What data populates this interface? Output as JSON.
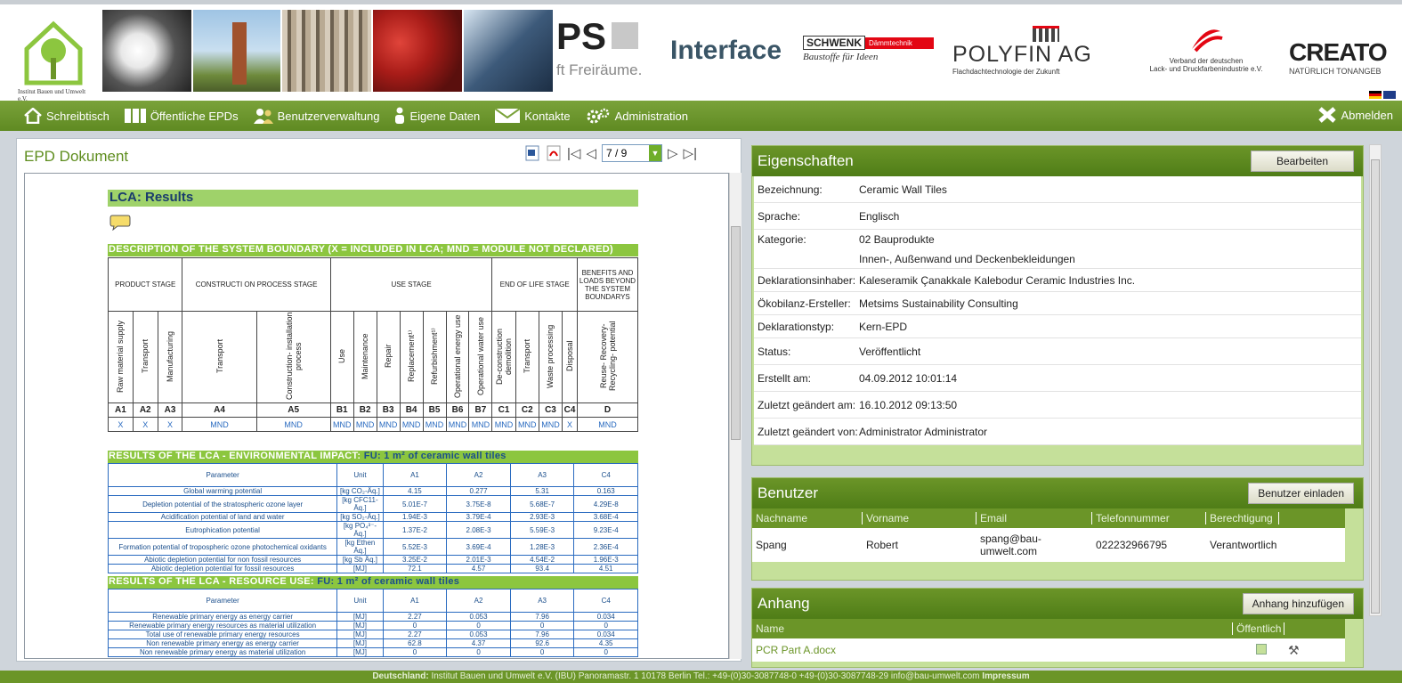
{
  "header": {
    "logo_text": "Institut Bauen\nund Umwelt e.V.",
    "ps_partial": "PS",
    "freiraeume": "ft Freiräume.",
    "interface": "Interface",
    "schwenk": "SCHWENK",
    "schwenk_sub": "Dämmtechnik",
    "schwenk_slogan": "Baustoffe für Ideen",
    "polyfin": "POLYFIN AG",
    "polyfin_sub": "Flachdachtechnologie der Zukunft",
    "verband": "Verband der deutschen",
    "verband2": "Lack- und Druckfarbenindustrie e.V.",
    "creaton": "CREATO",
    "creaton_sub": "NATÜRLICH TONANGEB"
  },
  "nav": {
    "items": [
      "Schreibtisch",
      "Öffentliche EPDs",
      "Benutzerverwaltung",
      "Eigene Daten",
      "Kontakte",
      "Administration"
    ],
    "logout": "Abmelden"
  },
  "epd": {
    "title": "EPD Dokument",
    "page": "7 / 9",
    "lca_title": "LCA: Results",
    "boundary_title": "DESCRIPTION  OF THE SYSTEM  BOUNDARY  (X = INCLUDED  IN LCA;  MND = MODULE NOT  DECLARED)",
    "stages": [
      "PRODUCT STAGE",
      "CONSTRUCTI ON PROCESS STAGE",
      "USE STAGE",
      "END OF LIFE STAGE",
      "BENEFITS AND LOADS BEYOND THE SYSTEM BOUNDARYS"
    ],
    "modules": [
      "Raw material supply",
      "Transport",
      "Manufacturing",
      "Transport",
      "Construction- installation process",
      "Use",
      "Maintenance",
      "Repair",
      "Replacement¹⁾",
      "Refurbishment¹⁾",
      "Operational energy use",
      "Operational water use",
      "De-construction demolition",
      "Transport",
      "Waste processing",
      "Disposal",
      "Reuse- Recovery- Recycling- potential"
    ],
    "codes": [
      "A1",
      "A2",
      "A3",
      "A4",
      "A5",
      "B1",
      "B2",
      "B3",
      "B4",
      "B5",
      "B6",
      "B7",
      "C1",
      "C2",
      "C3",
      "C4",
      "D"
    ],
    "values": [
      "X",
      "X",
      "X",
      "MND",
      "MND",
      "MND",
      "MND",
      "MND",
      "MND",
      "MND",
      "MND",
      "MND",
      "MND",
      "MND",
      "MND",
      "X",
      "MND"
    ],
    "env_title": "RESULTS  OF THE LCA  - ENVIRONMENTAL  IMPACT:",
    "env_fu": "FU:  1 m² of ceramic wall tiles",
    "env_cols": [
      "Parameter",
      "Unit",
      "A1",
      "A2",
      "A3",
      "C4"
    ],
    "env_rows": [
      [
        "Global warming potential",
        "[kg CO₂-Äq.]",
        "4.15",
        "0.277",
        "5.31",
        "0.163"
      ],
      [
        "Depletion potential of the stratospheric ozone layer",
        "[kg CFC11-Äq.]",
        "5.01E-7",
        "3.75E-8",
        "5.68E-7",
        "4.29E-8"
      ],
      [
        "Acidification potential of land and water",
        "[kg SO₂-Äq.]",
        "1.94E-3",
        "3.79E-4",
        "2.93E-3",
        "3.68E-4"
      ],
      [
        "Eutrophication potential",
        "[kg PO₄³⁻- Äq.]",
        "1.37E-2",
        "2.08E-3",
        "5.59E-3",
        "9.23E-4"
      ],
      [
        "Formation potential of tropospheric ozone photochemical oxidants",
        "[kg Ethen Äq.]",
        "5.52E-3",
        "3.69E-4",
        "1.28E-3",
        "2.36E-4"
      ],
      [
        "Abiotic depletion potential for non fossil resources",
        "[kg Sb Äq.]",
        "3.25E-2",
        "2.01E-3",
        "4.54E-2",
        "1.96E-3"
      ],
      [
        "Abiotic depletion potential for fossil resources",
        "[MJ]",
        "72.1",
        "4.57",
        "93.4",
        "4.51"
      ]
    ],
    "res_title": "RESULTS  OF THE LCA  - RESOURCE  USE:",
    "res_fu": "FU:  1 m² of ceramic wall tiles",
    "res_cols": [
      "Parameter",
      "Unit",
      "A1",
      "A2",
      "A3",
      "C4"
    ],
    "res_rows": [
      [
        "Renewable primary energy as energy carrier",
        "[MJ]",
        "2.27",
        "0.053",
        "7.96",
        "0.034"
      ],
      [
        "Renewable primary energy resources as material utilization",
        "[MJ]",
        "0",
        "0",
        "0",
        "0"
      ],
      [
        "Total use of renewable primary energy resources",
        "[MJ]",
        "2.27",
        "0.053",
        "7.96",
        "0.034"
      ],
      [
        "Non renewable primary energy as energy carrier",
        "[MJ]",
        "62.8",
        "4.37",
        "92.6",
        "4.35"
      ],
      [
        "Non renewable primary energy as material utilization",
        "[MJ]",
        "0",
        "0",
        "0",
        "0"
      ]
    ]
  },
  "props": {
    "title": "Eigenschaften",
    "edit": "Bearbeiten",
    "rows": [
      {
        "k": "Bezeichnung:",
        "v": "Ceramic Wall Tiles"
      },
      {
        "k": "Sprache:",
        "v": "Englisch"
      },
      {
        "k": "Kategorie:",
        "v": "02 Bauprodukte"
      },
      {
        "k": "",
        "v": "Innen-, Außenwand und Deckenbekleidungen"
      },
      {
        "k": "Deklarationsinhaber:",
        "v": "Kaleseramik Çanakkale Kalebodur Ceramic Industries Inc."
      },
      {
        "k": "Ökobilanz-Ersteller:",
        "v": "Metsims Sustainability Consulting"
      },
      {
        "k": "Deklarationstyp:",
        "v": "Kern-EPD"
      },
      {
        "k": "Status:",
        "v": "Veröffentlicht"
      },
      {
        "k": "Erstellt am:",
        "v": "04.09.2012 10:01:14"
      },
      {
        "k": "Zuletzt geändert am:",
        "v": "16.10.2012 09:13:50"
      },
      {
        "k": "Zuletzt geändert von:",
        "v": "Administrator Administrator"
      }
    ]
  },
  "users": {
    "title": "Benutzer",
    "invite": "Benutzer einladen",
    "cols": [
      "Nachname",
      "Vorname",
      "Email",
      "Telefonnummer",
      "Berechtigung"
    ],
    "rows": [
      [
        "Spang",
        "Robert",
        "spang@bau-umwelt.com",
        "022232966795",
        "Verantwortlich"
      ]
    ]
  },
  "attach": {
    "title": "Anhang",
    "add": "Anhang hinzufügen",
    "cols": [
      "Name",
      "Öffentlich"
    ],
    "rows": [
      [
        "PCR Part A.docx"
      ]
    ]
  },
  "footer": {
    "country": "Deutschland:",
    "text": "Institut Bauen und Umwelt e.V. (IBU)   Panoramastr. 1   10178 Berlin   Tel.: +49-(0)30-3087748-0   +49-(0)30-3087748-29   info@bau-umwelt.com",
    "impressum": "Impressum"
  },
  "colors": {
    "nav_green": "#6b9528",
    "light_green": "#8cc63f",
    "blue": "#1a4e8c"
  }
}
